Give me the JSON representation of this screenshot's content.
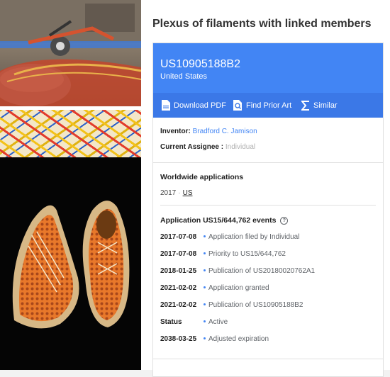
{
  "images": {
    "machine_alt": "",
    "mesh_alt": "",
    "shoes_alt": ""
  },
  "patent": {
    "title": "Plexus of filaments with linked members",
    "publication_number": "US10905188B2",
    "country": "United States"
  },
  "actions": {
    "download_pdf": "Download PDF",
    "find_prior_art": "Find Prior Art",
    "similar": "Similar",
    "download_icon": "pdf-file-icon",
    "prior_art_icon": "search-doc-icon",
    "similar_icon": "sigma-icon"
  },
  "meta": {
    "inventor_label": "Inventor:",
    "inventor": "Bradford C. Jamison",
    "assignee_label": "Current Assignee :",
    "assignee": "Individual"
  },
  "worldwide": {
    "title": "Worldwide applications",
    "year": "2017",
    "country": "US"
  },
  "events": {
    "title": "Application US15/644,762 events",
    "items": [
      {
        "date": "2017-07-08",
        "text": "Application filed by Individual"
      },
      {
        "date": "2017-07-08",
        "text": "Priority to US15/644,762"
      },
      {
        "date": "2018-01-25",
        "text": "Publication of US20180020762A1"
      },
      {
        "date": "2021-02-02",
        "text": "Application granted"
      },
      {
        "date": "2021-02-02",
        "text": "Publication of US10905188B2"
      },
      {
        "date": "Status",
        "text": "Active"
      },
      {
        "date": "2038-03-25",
        "text": "Adjusted expiration"
      }
    ]
  },
  "colors": {
    "header_blue": "#4285f4",
    "action_bar_blue": "#3b78e7",
    "link_blue": "#4285f4"
  }
}
